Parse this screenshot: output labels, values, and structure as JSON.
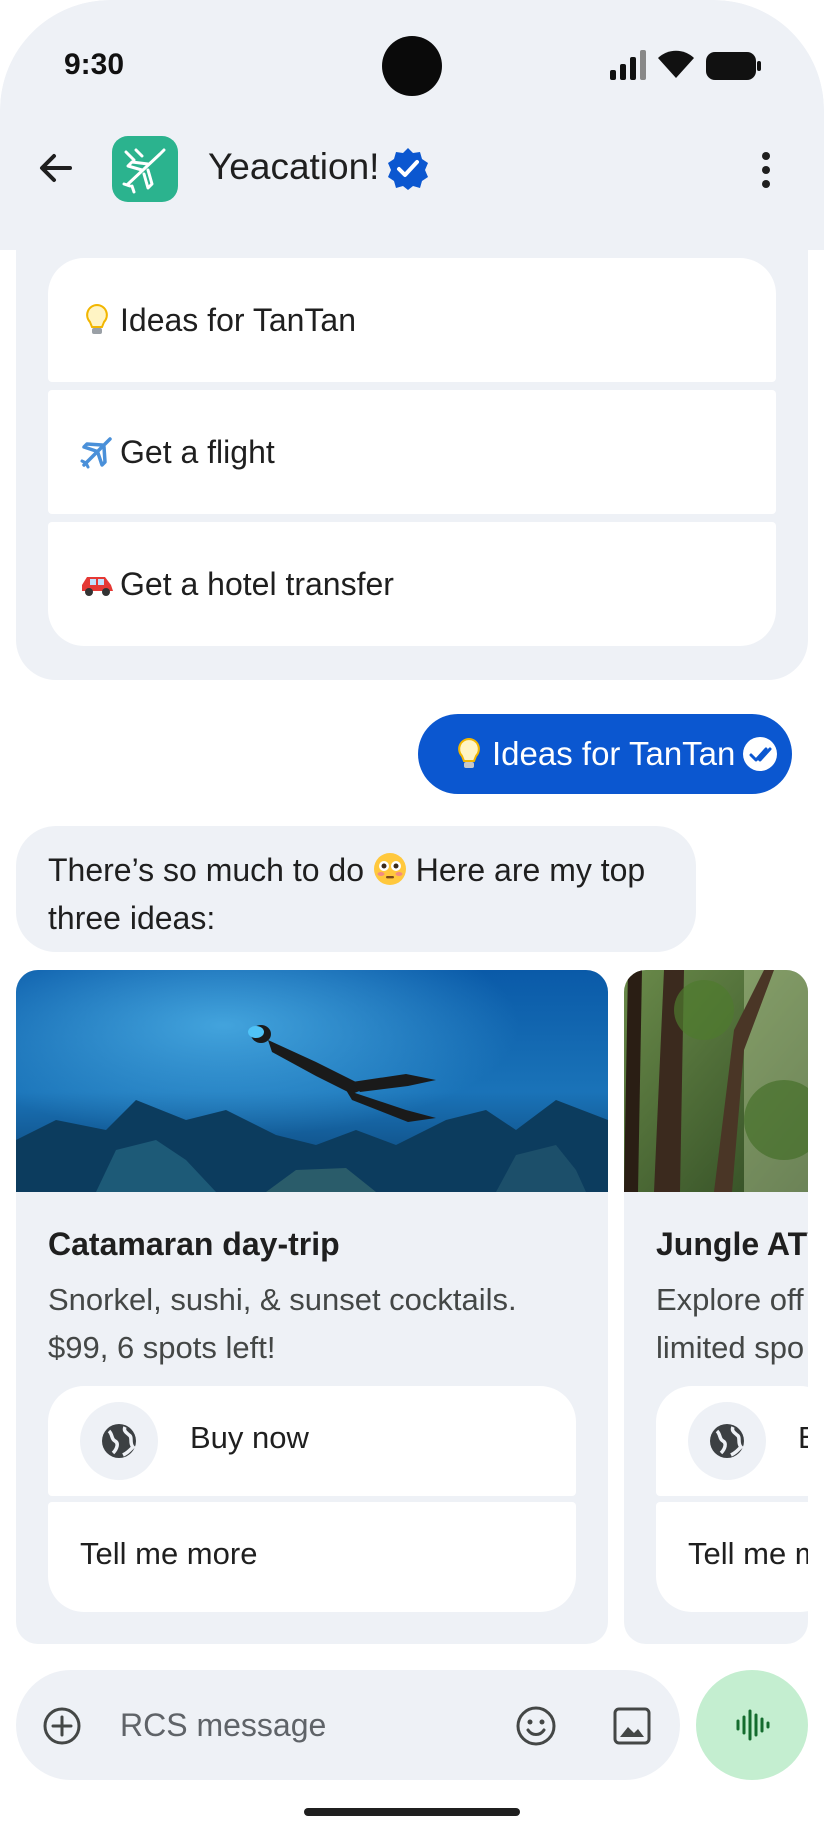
{
  "status_bar": {
    "time": "9:30"
  },
  "header": {
    "title": "Yeacation!",
    "icons": [
      "back-arrow-icon",
      "app-logo-icon",
      "verified-badge-icon",
      "more-vert-icon"
    ]
  },
  "suggestions": [
    {
      "emoji": "lightbulb",
      "label": "Ideas for TanTan"
    },
    {
      "emoji": "airplane",
      "label": "Get a flight"
    },
    {
      "emoji": "car",
      "label": "Get a hotel transfer"
    }
  ],
  "outgoing": {
    "text": "Ideas for TanTan",
    "status": "read"
  },
  "incoming": {
    "text_before": "There’s so much to do",
    "text_after": "Here are my top three ideas:"
  },
  "cards": [
    {
      "title": "Catamaran day-trip",
      "description_line1": "Snorkel, sushi, & sunset cocktails.",
      "description_line2": "$99, 6 spots left!",
      "primary_button": "Buy now",
      "secondary_button": "Tell me more"
    },
    {
      "title": "Jungle ATV",
      "description_line1": "Explore off",
      "description_line2": "limited spo",
      "primary_button": "Buy now",
      "secondary_button": "Tell me more"
    }
  ],
  "composer": {
    "placeholder": "RCS message"
  },
  "colors": {
    "accent": "#0b57d0",
    "surface": "#eef1f6",
    "mic": "#c4eed0",
    "logo": "#2bb38e"
  }
}
